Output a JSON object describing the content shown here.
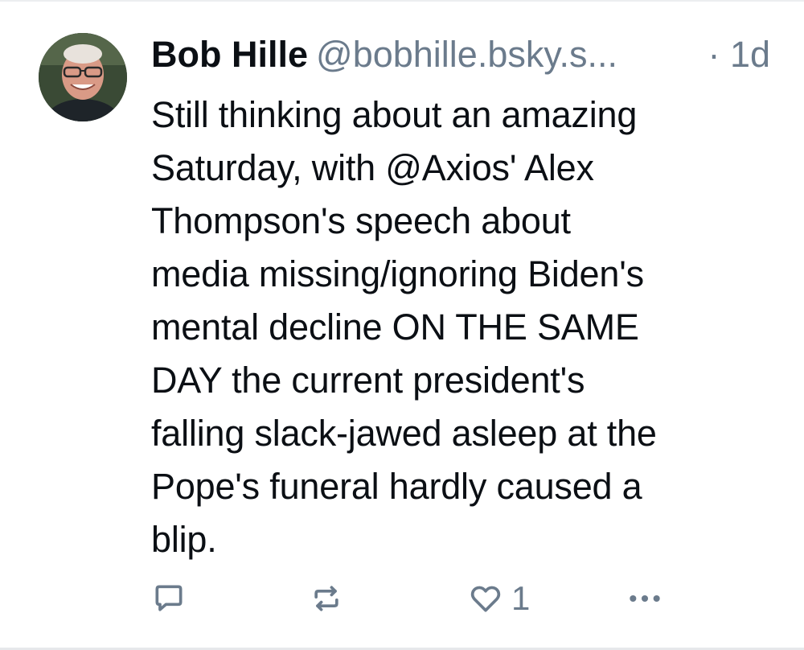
{
  "post": {
    "author": {
      "display_name": "Bob Hille",
      "handle": "@bobhille.bsky.s...",
      "avatar_icon": "avatar-photo"
    },
    "timestamp": "· 1d",
    "text": "Still thinking about an amazing\nSaturday, with @Axios' Alex\nThompson's speech about\nmedia missing/ignoring Biden's\nmental decline ON THE SAME\nDAY the current president's\nfalling slack-jawed asleep at the\nPope's funeral hardly caused a\nblip.",
    "actions": {
      "reply_icon": "reply-icon",
      "repost_icon": "repost-icon",
      "like_icon": "heart-icon",
      "like_count": "1",
      "more_icon": "more-options-icon"
    }
  },
  "colors": {
    "text": "#0b0f14",
    "muted": "#6b7b8c",
    "divider": "#e6e8eb"
  }
}
